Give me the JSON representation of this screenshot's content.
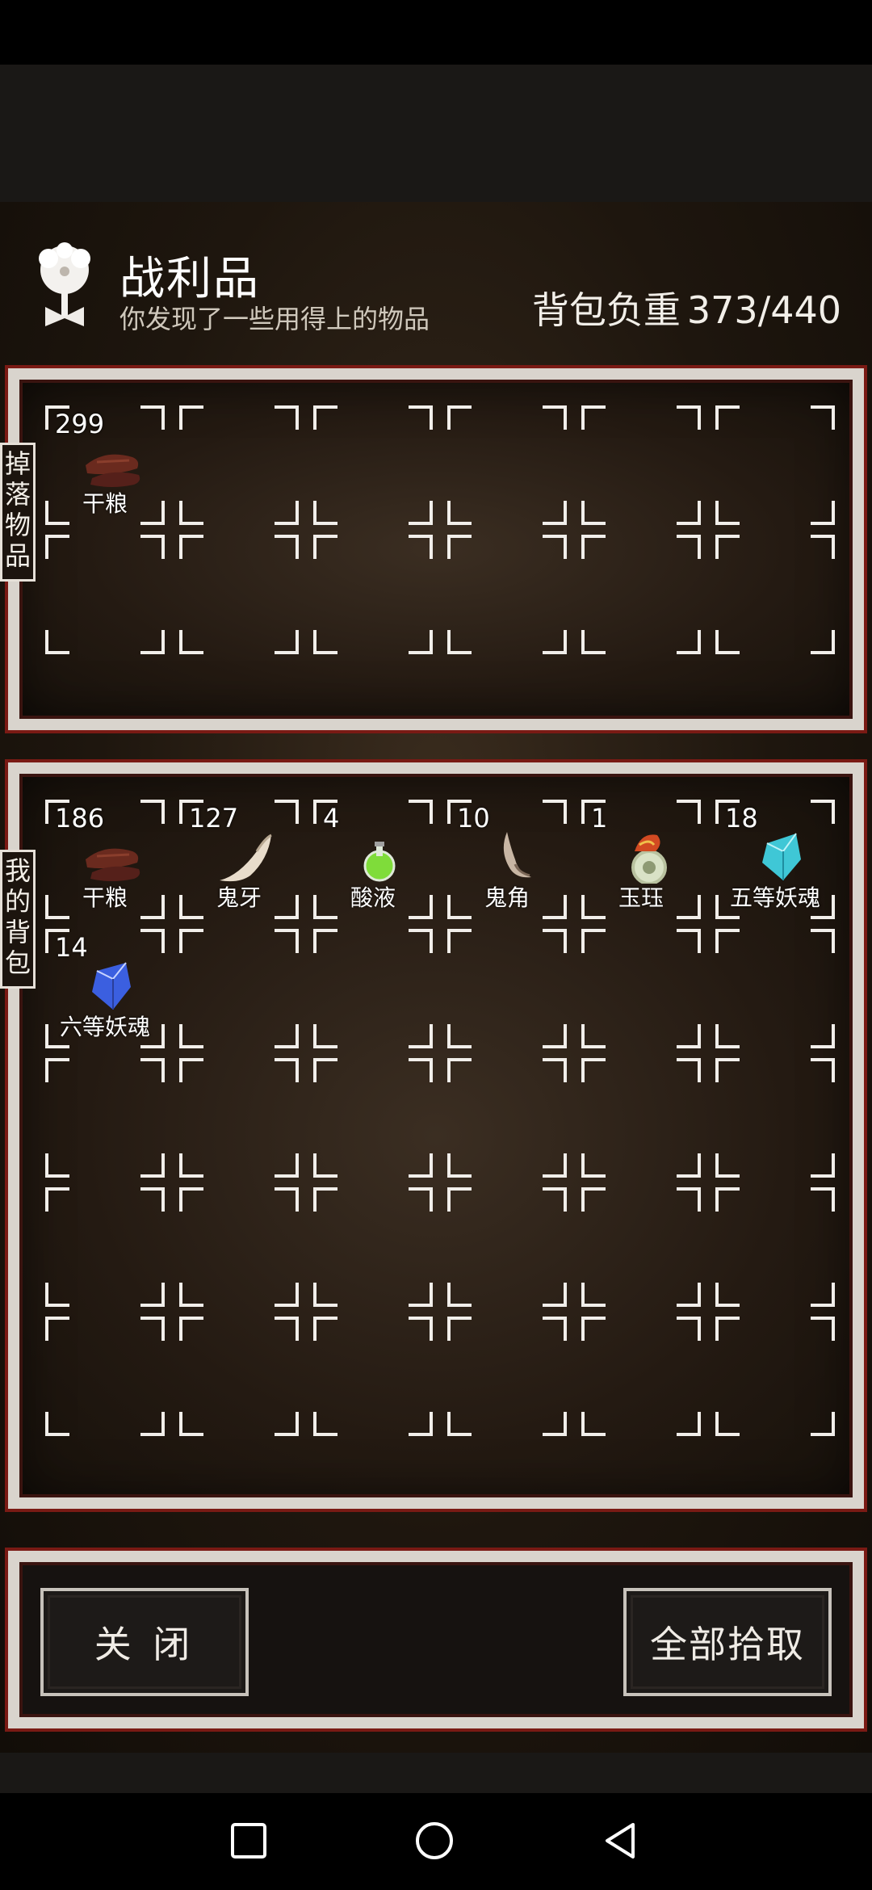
{
  "header": {
    "title": "战利品",
    "subtitle": "你发现了一些用得上的物品",
    "weight_label": "背包负重",
    "weight_value": "373/440"
  },
  "loot_panel": {
    "side_label": "掉落物品",
    "items": [
      {
        "name": "干粮",
        "qty": "299",
        "icon": "jerky-icon"
      }
    ]
  },
  "bag_panel": {
    "side_label": "我的背包",
    "items": [
      {
        "name": "干粮",
        "qty": "186",
        "icon": "jerky-icon"
      },
      {
        "name": "鬼牙",
        "qty": "127",
        "icon": "ghost-fang-icon"
      },
      {
        "name": "酸液",
        "qty": "4",
        "icon": "acid-potion-icon"
      },
      {
        "name": "鬼角",
        "qty": "10",
        "icon": "ghost-horn-icon"
      },
      {
        "name": "玉珏",
        "qty": "1",
        "icon": "jade-pendant-icon"
      },
      {
        "name": "五等妖魂",
        "qty": "18",
        "icon": "cyan-crystal-icon"
      },
      {
        "name": "六等妖魂",
        "qty": "14",
        "icon": "blue-crystal-icon"
      }
    ]
  },
  "actions": {
    "close_label": "关 闭",
    "take_all_label": "全部拾取"
  },
  "nav": {
    "recent": "square-icon",
    "home": "circle-icon",
    "back": "triangle-back-icon"
  }
}
